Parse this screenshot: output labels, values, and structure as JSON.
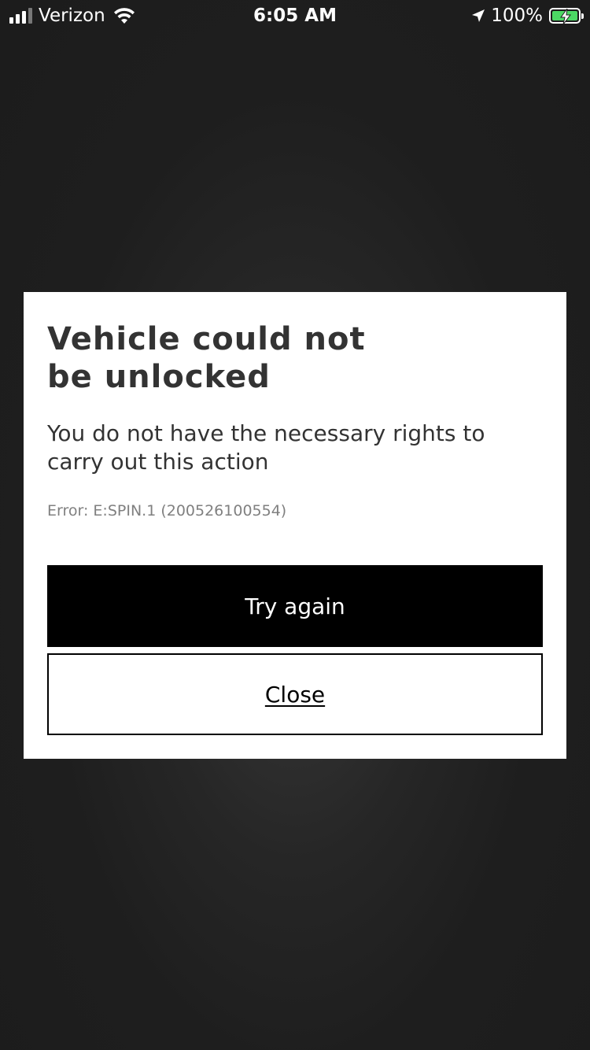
{
  "status_bar": {
    "carrier": "Verizon",
    "time": "6:05 AM",
    "battery_percent": "100%",
    "signal_bars": 3,
    "signal_bars_total": 4,
    "charging": true,
    "battery_color": "#4cd964",
    "icons": [
      "signal-icon",
      "wifi-icon",
      "location-arrow-icon",
      "battery-icon"
    ]
  },
  "dialog": {
    "title": "Vehicle could not be unlocked",
    "message": "You do not have the necessary rights to carry out this action",
    "error": "Error: E:SPIN.1 (200526100554)",
    "primary_button": "Try again",
    "secondary_button": "Close"
  },
  "colors": {
    "background": "#1e1e1e",
    "dialog_background": "#ffffff",
    "primary_button": "#000000",
    "text": "#333333",
    "error_text": "#808080"
  }
}
